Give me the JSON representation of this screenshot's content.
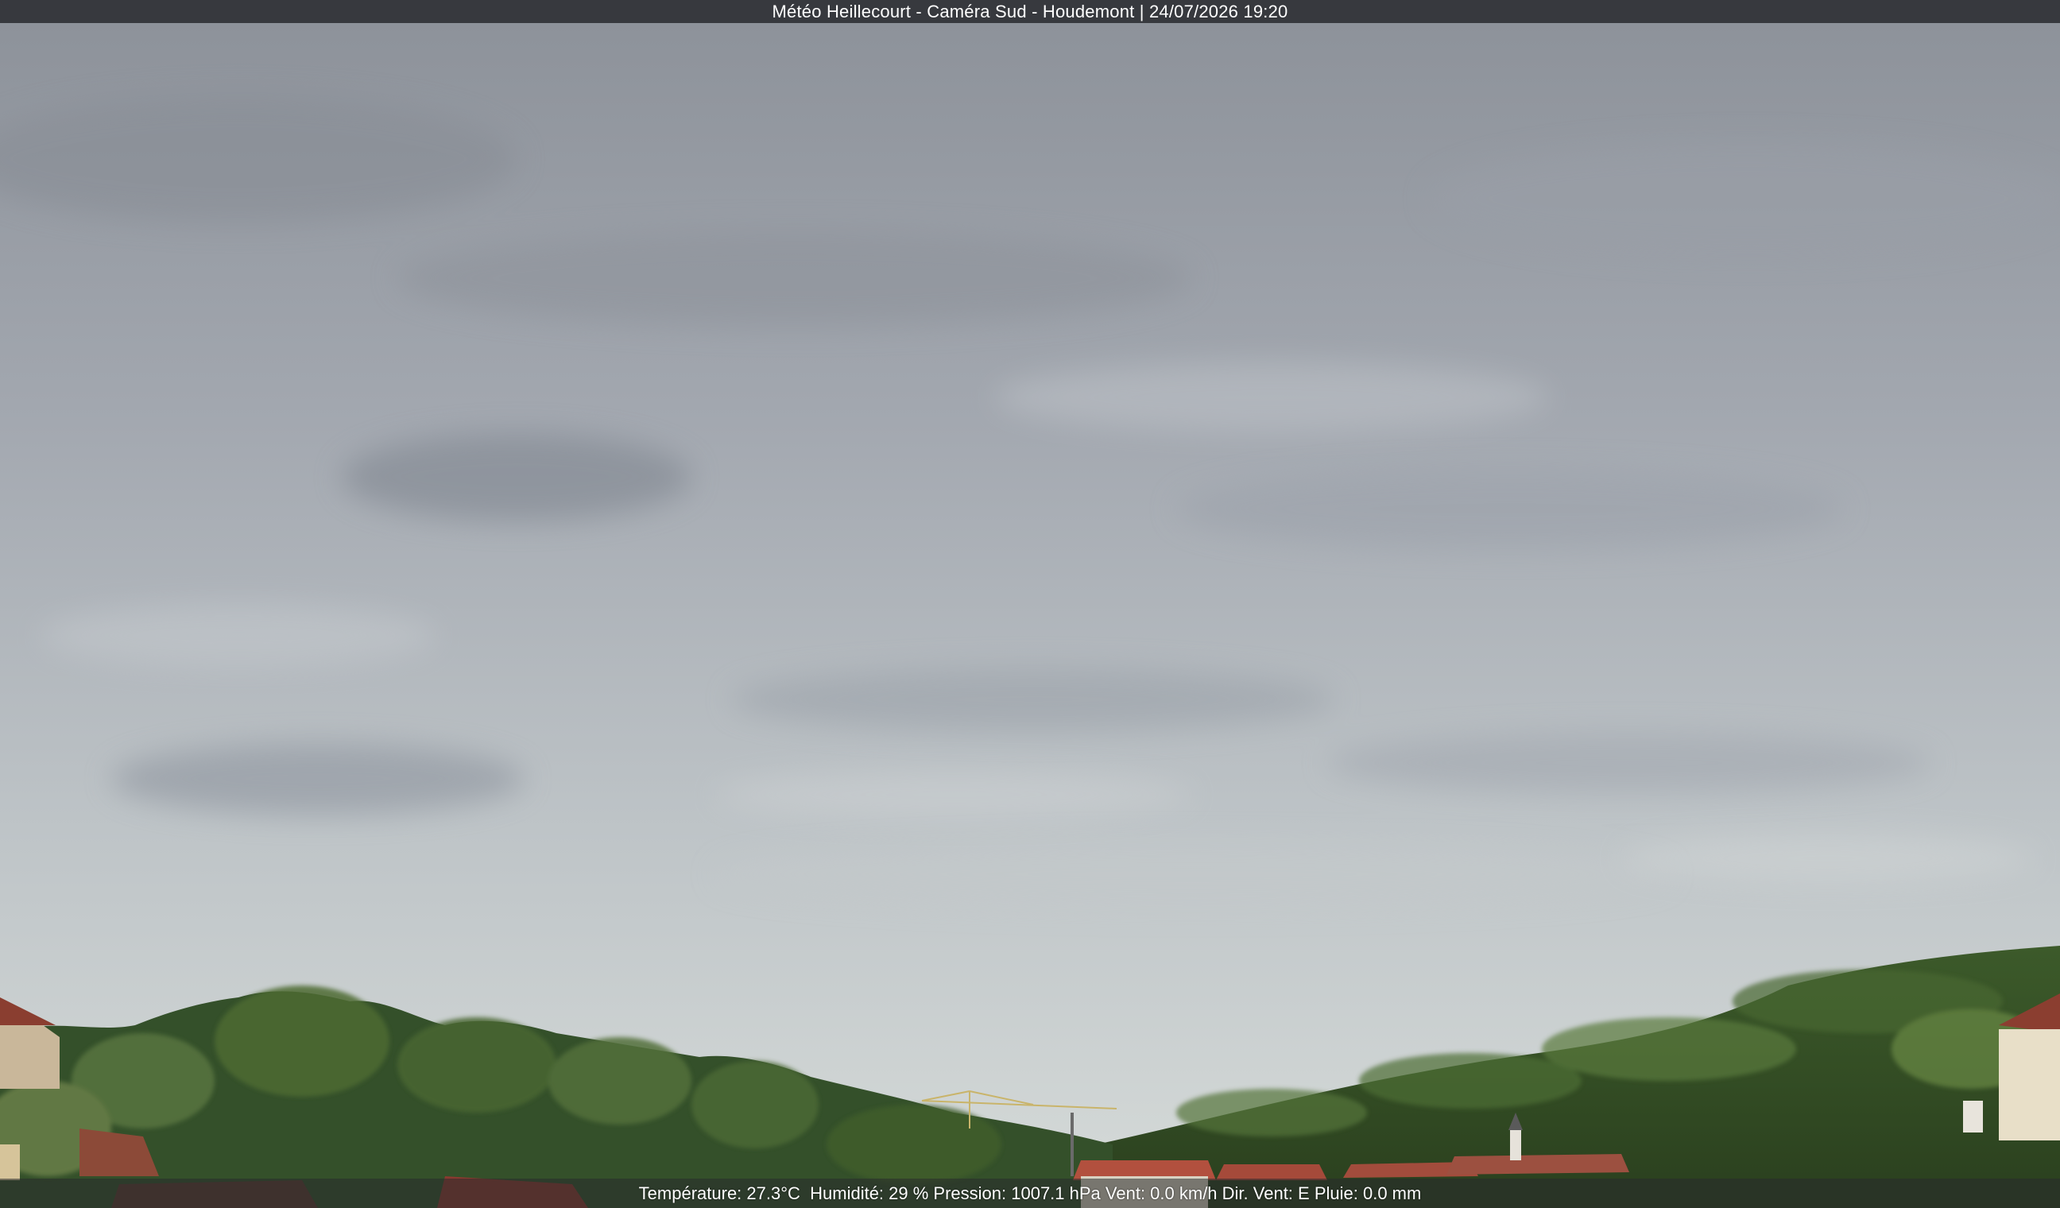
{
  "overlay": {
    "title": "Météo Heillecourt - Caméra Sud - Houdemont | 24/07/2026 19:20",
    "weather": {
      "temperature": "Température: 27.3°C ",
      "humidity": " Humidité: 29 % ",
      "pressure": "Pression: 1007.1 hPa ",
      "wind_speed": "Vent: 0.0 km/h ",
      "wind_dir": "Dir. Vent: E ",
      "rain": "Pluie: 0.0 mm"
    }
  },
  "colors": {
    "sky_top": "#8f949c",
    "sky_mid": "#a7acb3",
    "sky_horizon": "#d2d7d6",
    "trees_dark": "#2f4a22",
    "trees_light": "#5f7d3a",
    "roof": "#9a4a3a"
  }
}
